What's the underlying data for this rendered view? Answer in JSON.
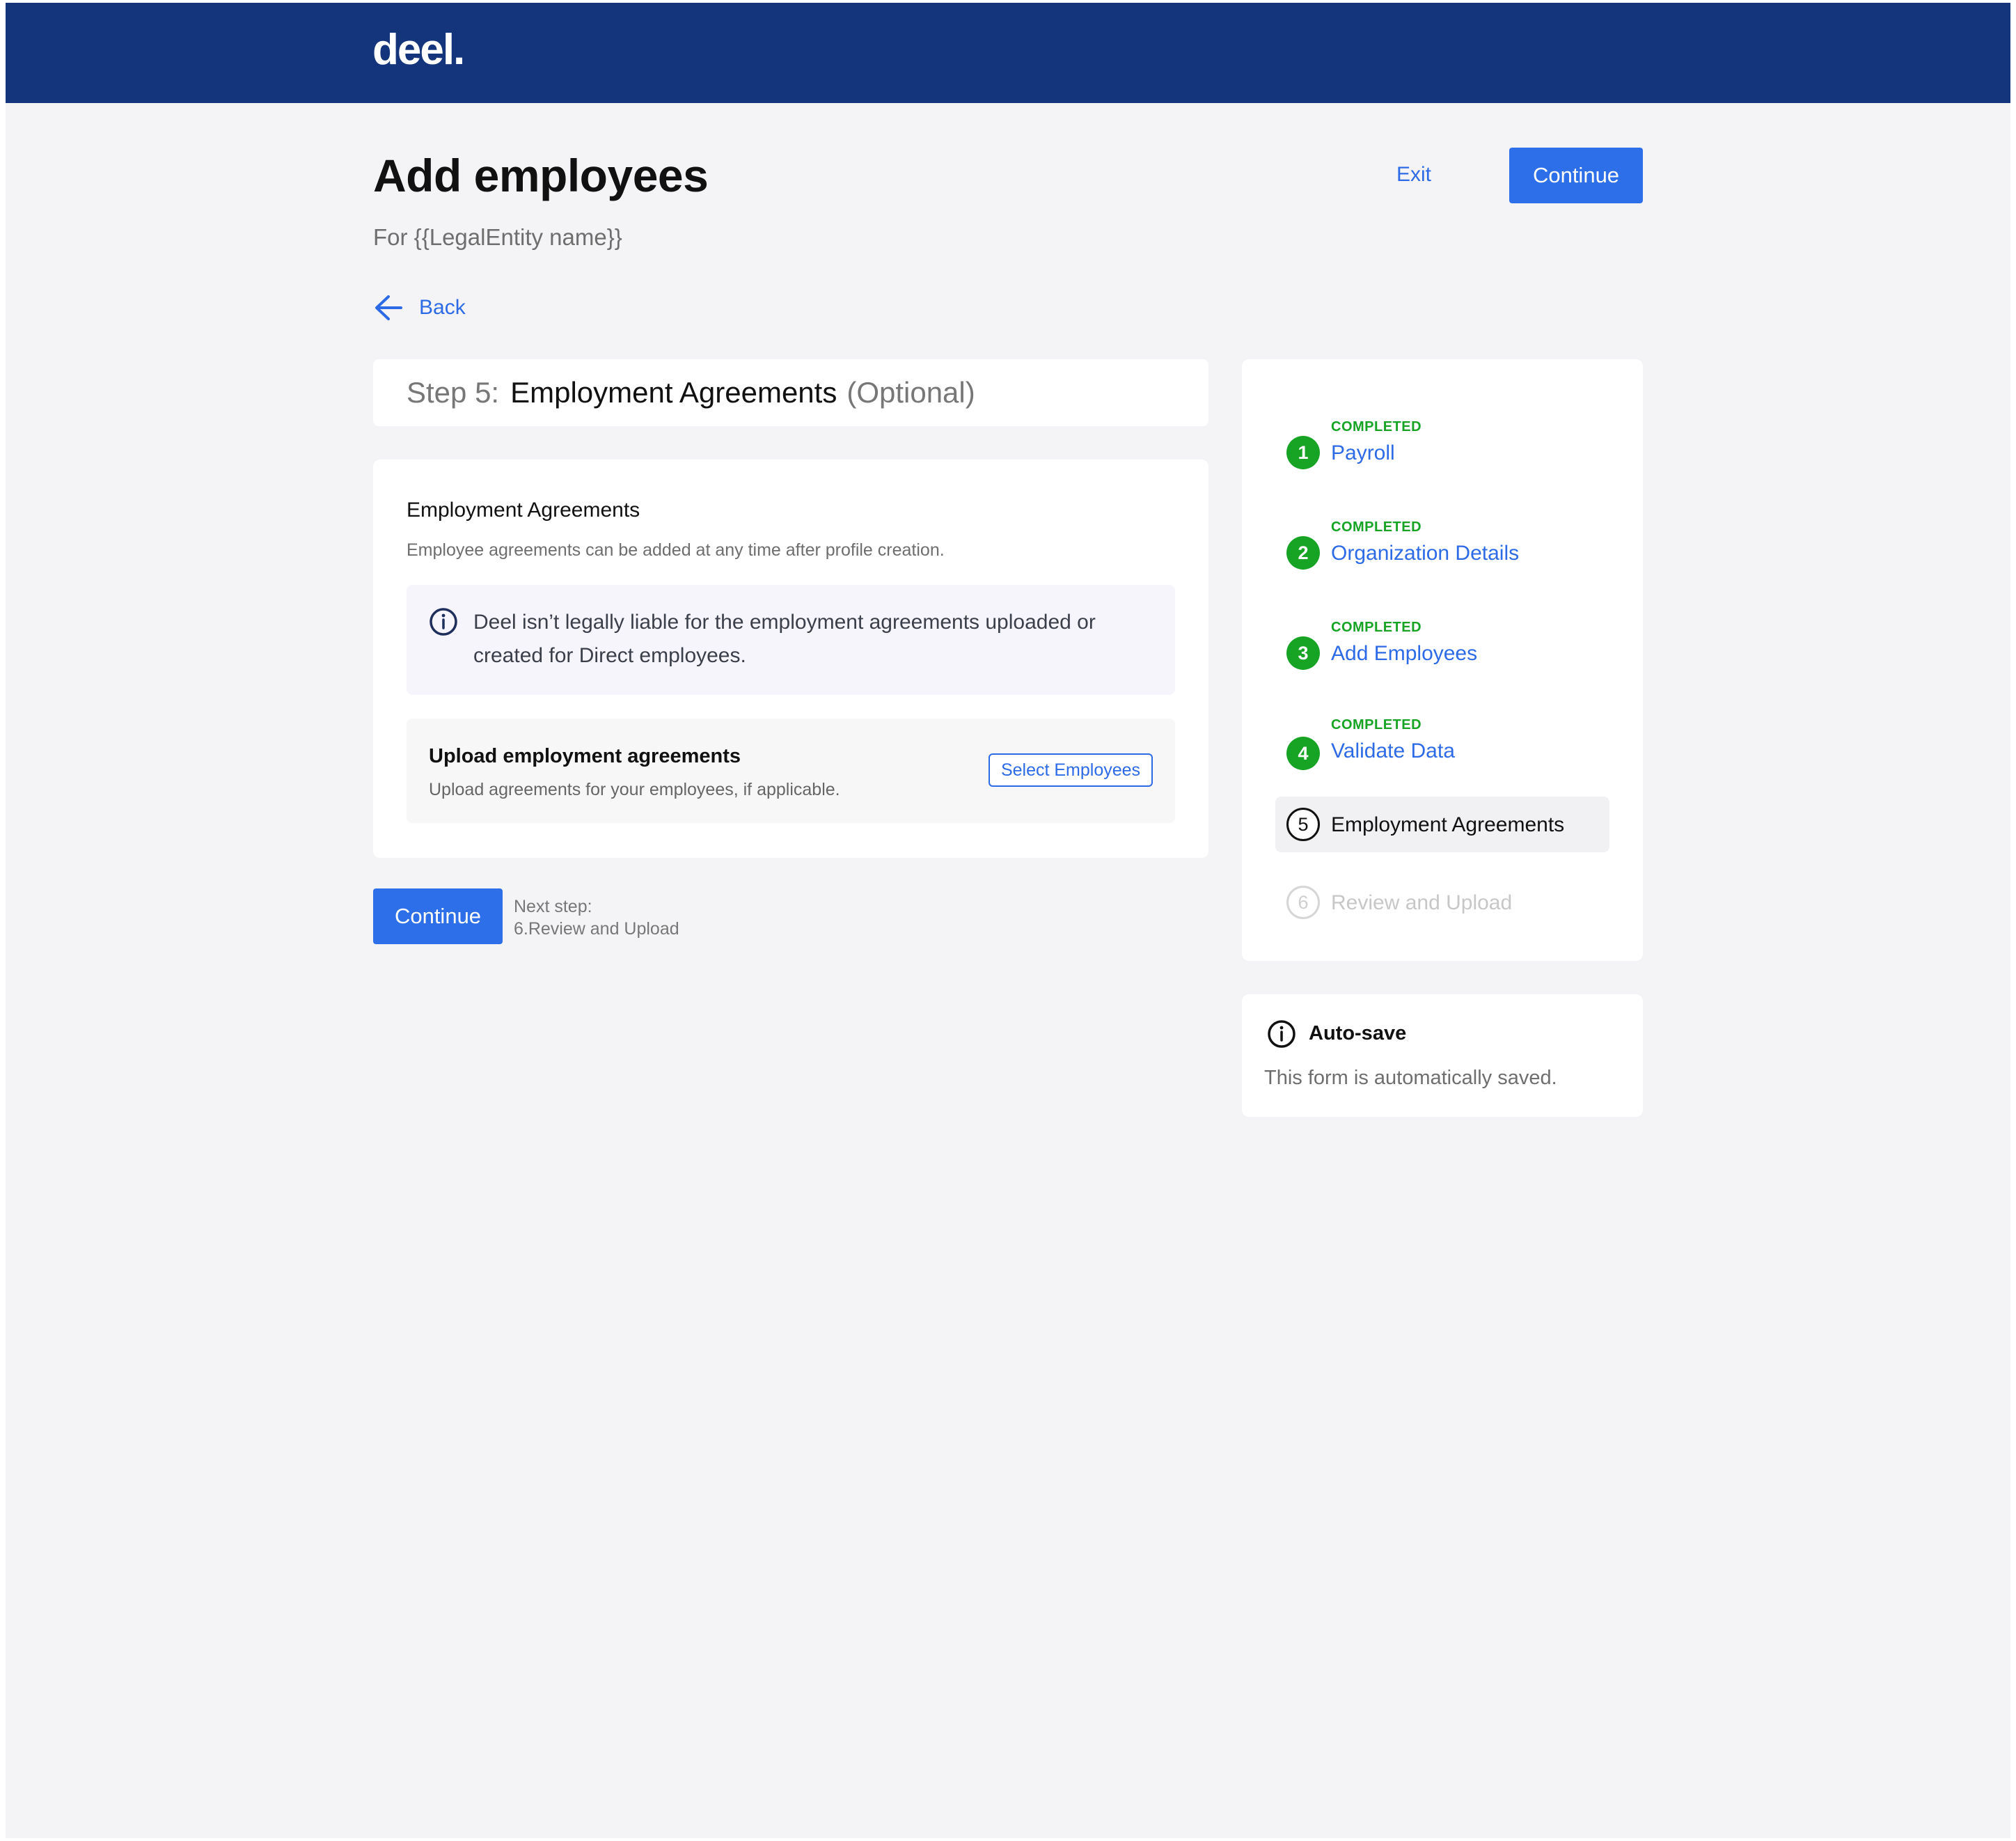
{
  "header": {
    "logo": "deel."
  },
  "page": {
    "title": "Add employees",
    "subtitle": "For {{LegalEntity name}}",
    "exit_label": "Exit",
    "continue_label": "Continue",
    "back_label": "Back"
  },
  "step": {
    "prefix": "Step 5:",
    "name": "Employment Agreements",
    "optional": "(Optional)"
  },
  "card": {
    "title": "Employment Agreements",
    "description": "Employee agreements can be added at any time after profile creation.",
    "info_text": "Deel isn’t legally liable for the employment agreements uploaded or created for Direct employees.",
    "upload": {
      "title": "Upload employment agreements",
      "description": "Upload agreements for your employees, if applicable.",
      "button_label": "Select Employees"
    }
  },
  "footer": {
    "continue_label": "Continue",
    "next_step_label": "Next step:",
    "next_step_value": "6.Review and Upload"
  },
  "stepper": {
    "items": [
      {
        "number": "1",
        "status": "COMPLETED",
        "label": "Payroll",
        "state": "done"
      },
      {
        "number": "2",
        "status": "COMPLETED",
        "label": "Organization Details",
        "state": "done"
      },
      {
        "number": "3",
        "status": "COMPLETED",
        "label": "Add Employees",
        "state": "done"
      },
      {
        "number": "4",
        "status": "COMPLETED",
        "label": "Validate Data",
        "state": "done"
      },
      {
        "number": "5",
        "status": "",
        "label": "Employment Agreements",
        "state": "current"
      },
      {
        "number": "6",
        "status": "",
        "label": "Review and Upload",
        "state": "todo"
      }
    ]
  },
  "autosave": {
    "title": "Auto-save",
    "description": "This form is automatically saved."
  },
  "colors": {
    "brand_navy": "#14357c",
    "primary_blue": "#2d6fe8",
    "link_blue": "#2d6be6",
    "success_green": "#17a324"
  },
  "icons": {
    "back": "arrow-left-icon",
    "info": "info-circle-icon"
  }
}
